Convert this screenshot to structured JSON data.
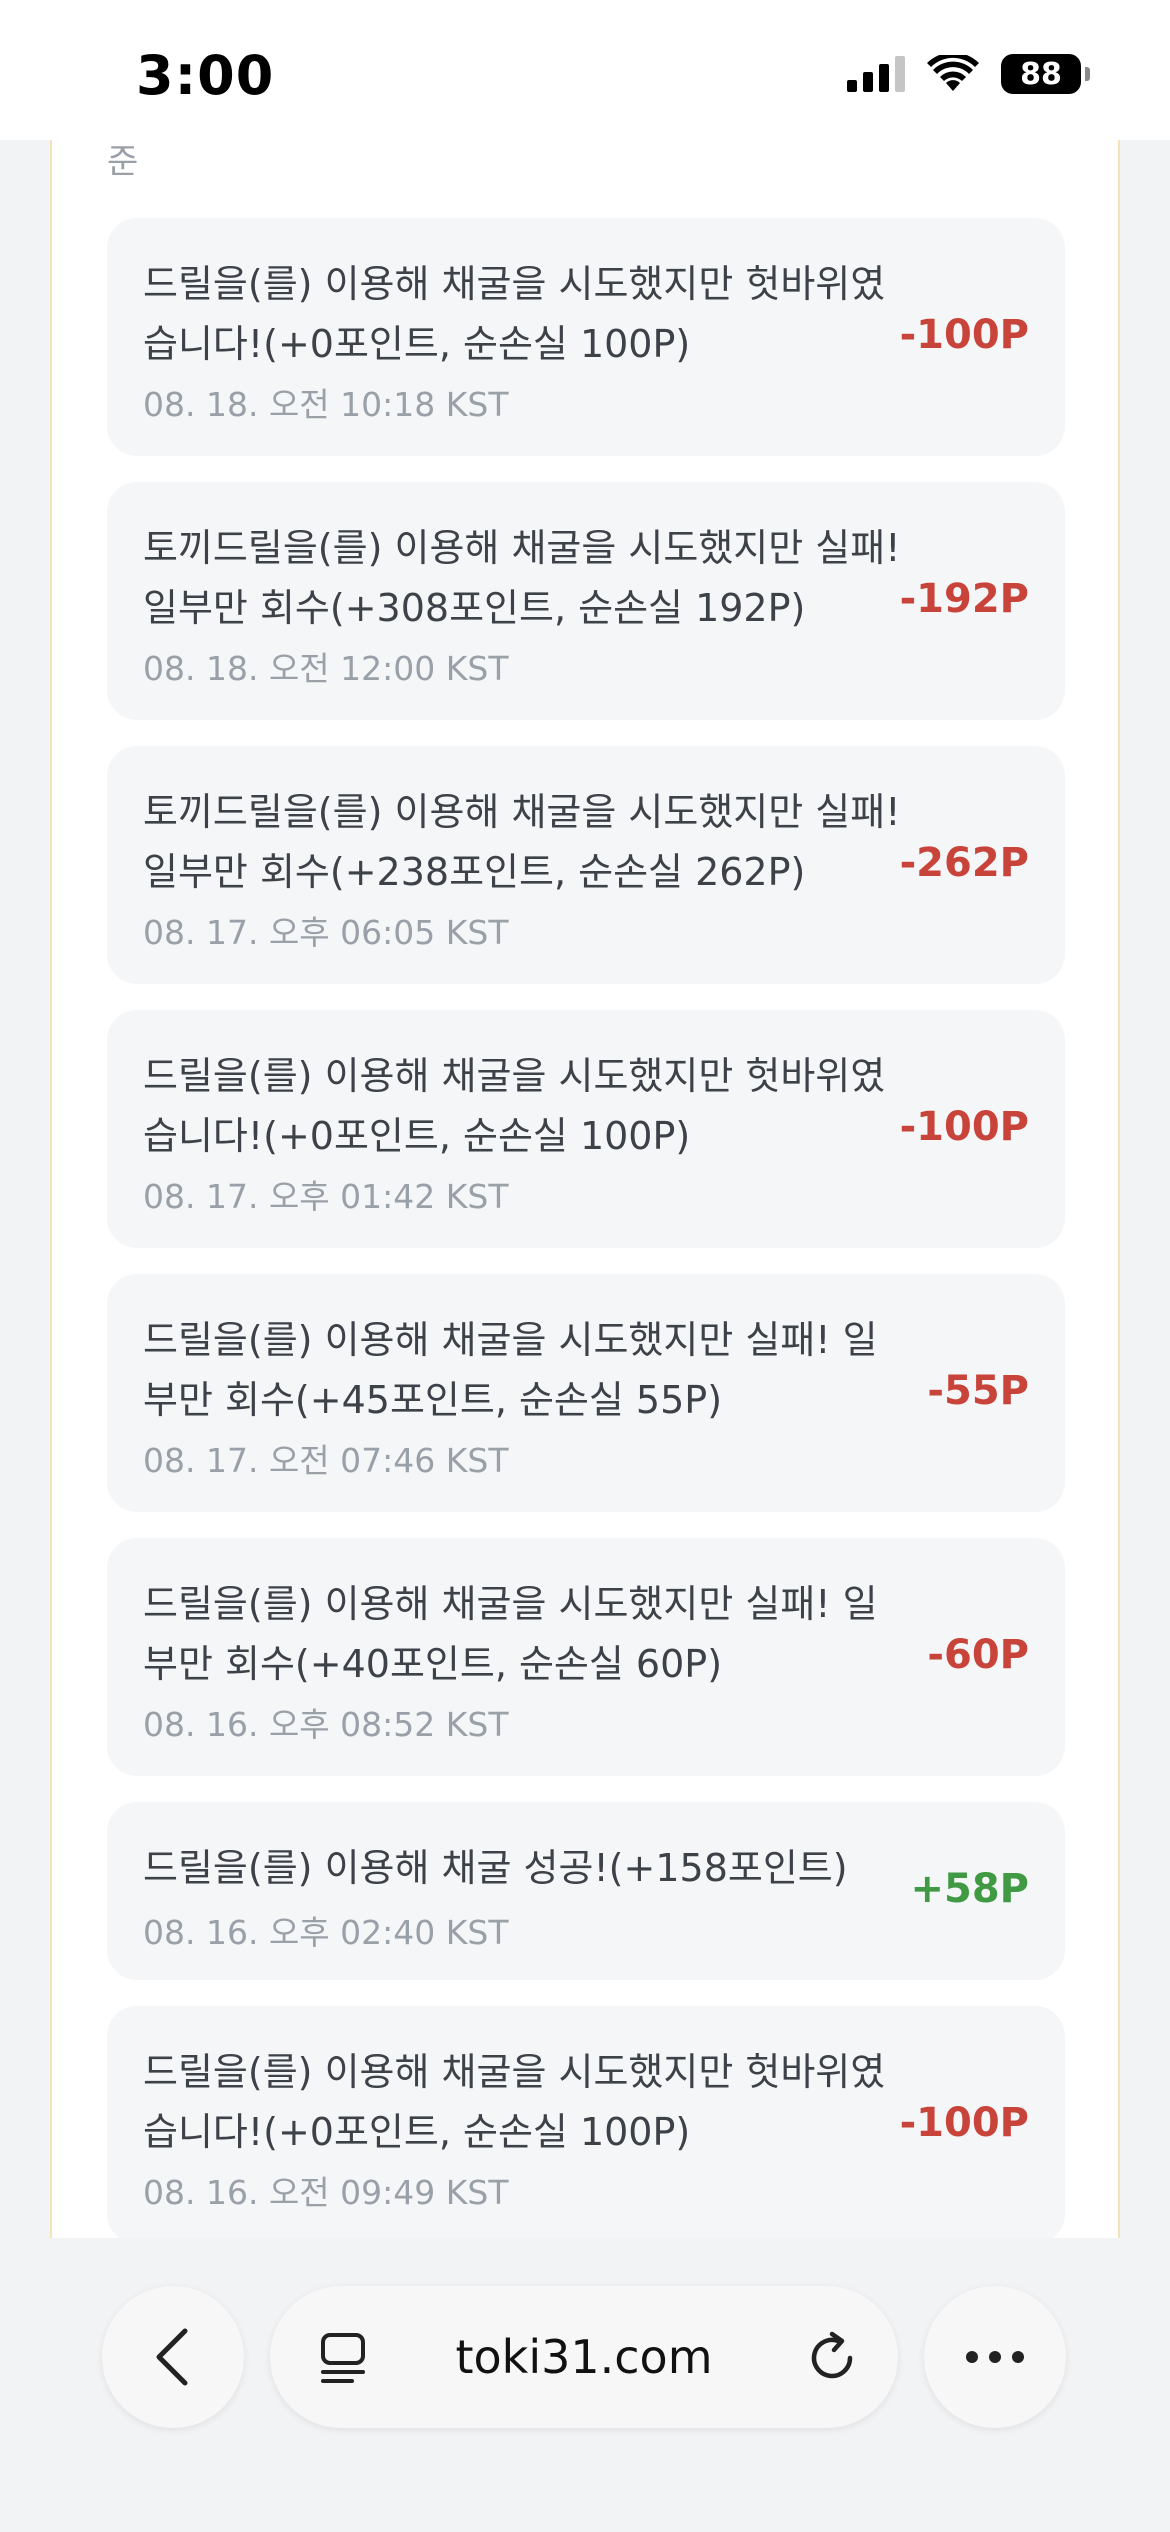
{
  "status_bar": {
    "time": "3:00",
    "battery": "88"
  },
  "partial_header_text": "준",
  "items": [
    {
      "desc": "드릴을(를) 이용해 채굴을 시도했지만 헛바위였습니다!(+0포인트, 순손실 100P)",
      "date": "08. 18. 오전 10:18 KST",
      "amount": "-100P",
      "type": "negative"
    },
    {
      "desc": "토끼드릴을(를) 이용해 채굴을 시도했지만 실패! 일부만 회수(+308포인트, 순손실 192P)",
      "date": "08. 18. 오전 12:00 KST",
      "amount": "-192P",
      "type": "negative"
    },
    {
      "desc": "토끼드릴을(를) 이용해 채굴을 시도했지만 실패! 일부만 회수(+238포인트, 순손실 262P)",
      "date": "08. 17. 오후 06:05 KST",
      "amount": "-262P",
      "type": "negative"
    },
    {
      "desc": "드릴을(를) 이용해 채굴을 시도했지만 헛바위였습니다!(+0포인트, 순손실 100P)",
      "date": "08. 17. 오후 01:42 KST",
      "amount": "-100P",
      "type": "negative"
    },
    {
      "desc": "드릴을(를) 이용해 채굴을 시도했지만 실패! 일부만 회수(+45포인트, 순손실 55P)",
      "date": "08. 17. 오전 07:46 KST",
      "amount": "-55P",
      "type": "negative"
    },
    {
      "desc": "드릴을(를) 이용해 채굴을 시도했지만 실패! 일부만 회수(+40포인트, 순손실 60P)",
      "date": "08. 16. 오후 08:52 KST",
      "amount": "-60P",
      "type": "negative"
    },
    {
      "desc": "드릴을(를) 이용해 채굴 성공!(+158포인트)",
      "date": "08. 16. 오후 02:40 KST",
      "amount": "+58P",
      "type": "positive"
    },
    {
      "desc": "드릴을(를) 이용해 채굴을 시도했지만 헛바위였습니다!(+0포인트, 순손실 100P)",
      "date": "08. 16. 오전 09:49 KST",
      "amount": "-100P",
      "type": "negative"
    }
  ],
  "browser_bar": {
    "url": "toki31.com"
  },
  "colors": {
    "negative": "#c8443a",
    "positive": "#3f9a43"
  }
}
